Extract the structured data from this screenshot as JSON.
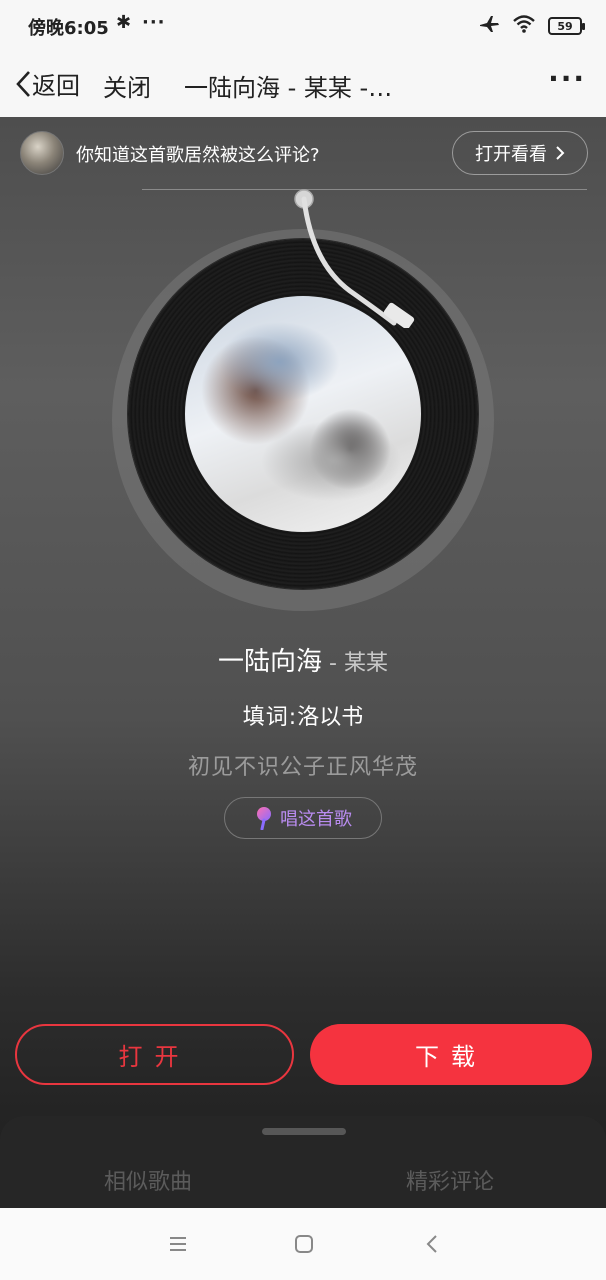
{
  "status_bar": {
    "time": "傍晚6:05",
    "bluetooth_glyph": "✱",
    "more_glyph": "···",
    "battery": "59",
    "icons": [
      "bluetooth-icon",
      "airplane-icon",
      "wifi-icon",
      "battery-icon"
    ]
  },
  "nav": {
    "back_label": "返回",
    "close_label": "关闭",
    "title": "一陆向海 - 某某 -…",
    "more_glyph": "···"
  },
  "promo": {
    "text": "你知道这首歌居然被这么评论?",
    "button_label": "打开看看"
  },
  "song": {
    "title": "一陆向海",
    "separator": " - ",
    "artist": "某某",
    "lyricist_label": "填词:",
    "lyricist": "洛以书",
    "lyric_line": "初见不识公子正风华茂",
    "sing_label": "唱这首歌"
  },
  "actions": {
    "open_label": "打开",
    "download_label": "下载"
  },
  "sheet": {
    "tab_similar": "相似歌曲",
    "tab_comments": "精彩评论"
  },
  "colors": {
    "accent_red": "#f5333f",
    "sing_purple": "#b98cf0"
  }
}
